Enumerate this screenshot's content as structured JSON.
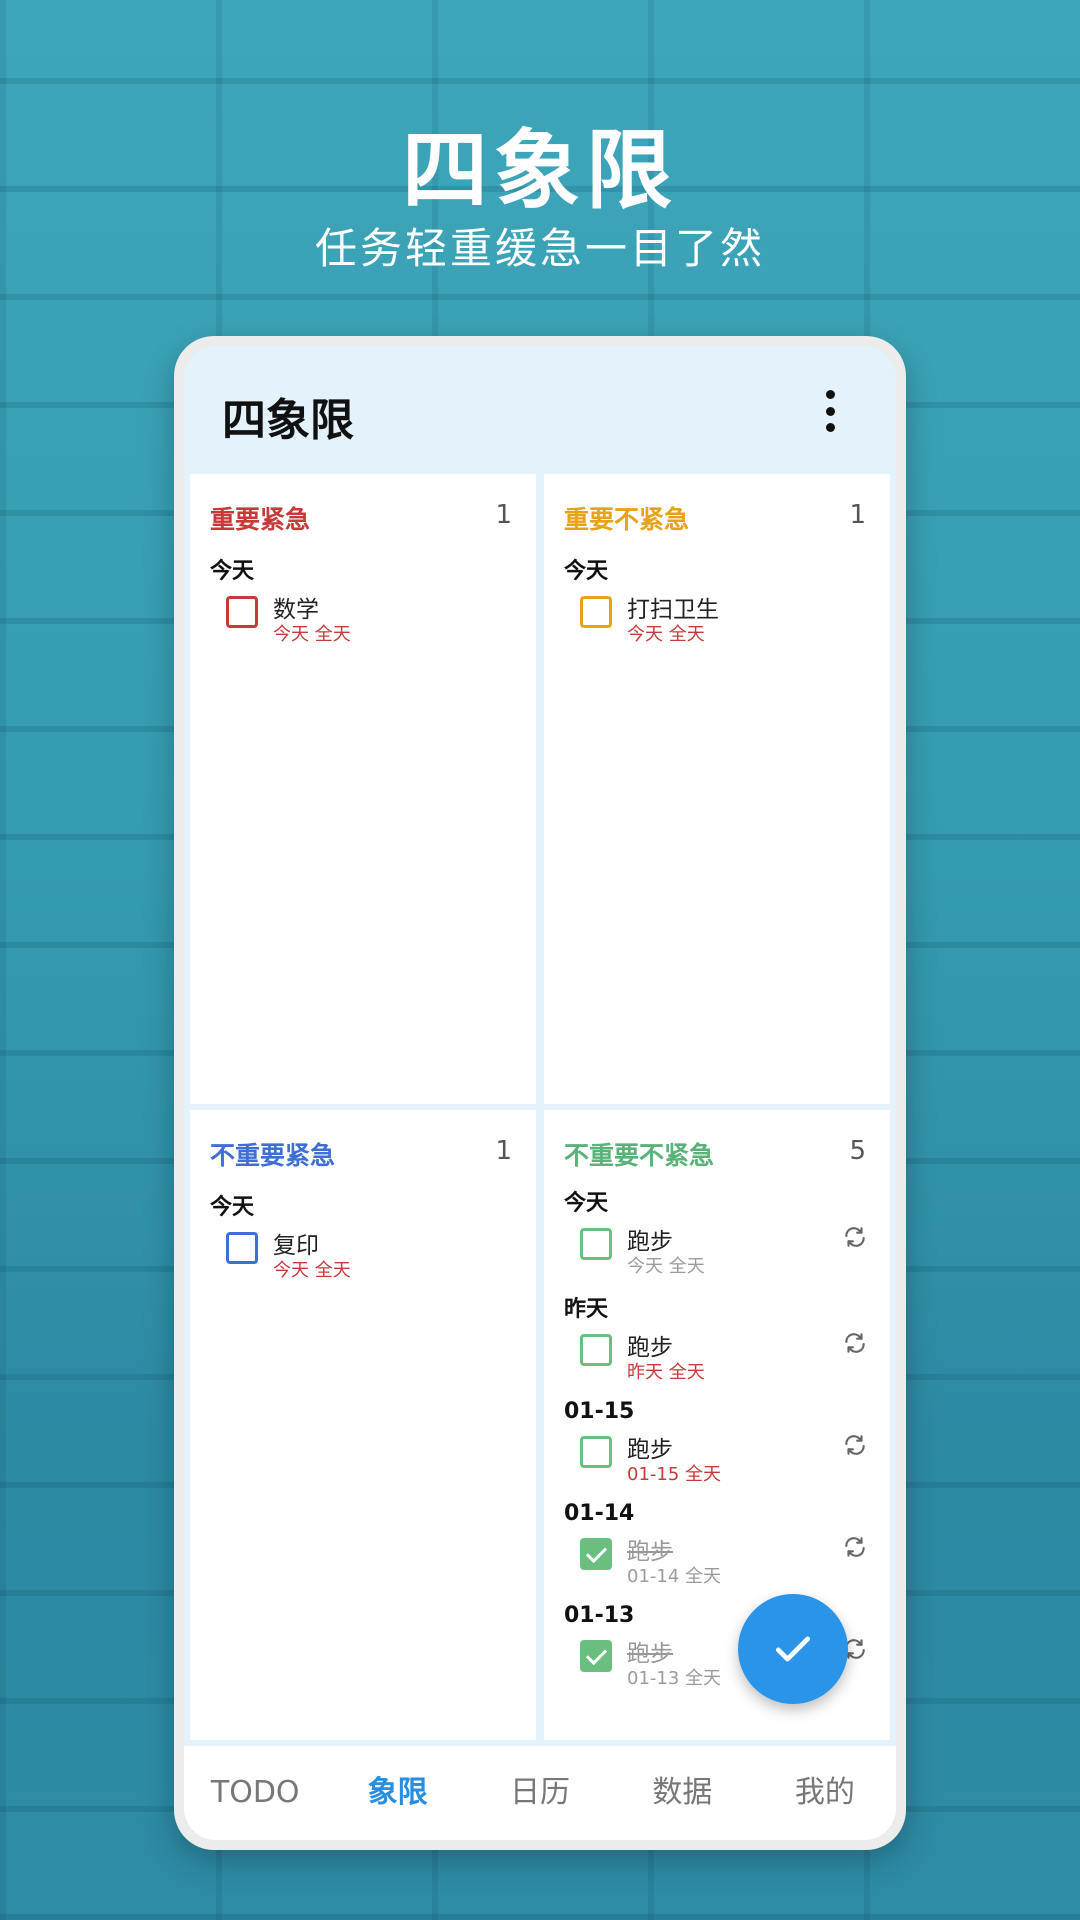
{
  "promo": {
    "title": "四象限",
    "subtitle": "任务轻重缓急一目了然"
  },
  "app": {
    "title": "四象限",
    "menu_icon": "more-vert-icon"
  },
  "colors": {
    "q1": "#c83a3a",
    "q2": "#e8a21a",
    "q3": "#3d6fd6",
    "q4": "#5ab27a",
    "accent": "#2a94e8"
  },
  "quadrants": [
    {
      "title": "重要紧急",
      "count": "1",
      "groups": [
        {
          "label": "今天",
          "tasks": [
            {
              "name": "数学",
              "meta": "今天 全天"
            }
          ]
        }
      ]
    },
    {
      "title": "重要不紧急",
      "count": "1",
      "groups": [
        {
          "label": "今天",
          "tasks": [
            {
              "name": "打扫卫生",
              "meta": "今天 全天"
            }
          ]
        }
      ]
    },
    {
      "title": "不重要紧急",
      "count": "1",
      "groups": [
        {
          "label": "今天",
          "tasks": [
            {
              "name": "复印",
              "meta": "今天 全天"
            }
          ]
        }
      ]
    },
    {
      "title": "不重要不紧急",
      "count": "5",
      "groups": [
        {
          "label": "今天",
          "tasks": [
            {
              "name": "跑步",
              "meta": "今天 全天",
              "repeat": true
            }
          ]
        },
        {
          "label": "昨天",
          "tasks": [
            {
              "name": "跑步",
              "meta": "昨天 全天",
              "repeat": true
            }
          ]
        },
        {
          "label": "01-15",
          "tasks": [
            {
              "name": "跑步",
              "meta": "01-15 全天",
              "repeat": true
            }
          ]
        },
        {
          "label": "01-14",
          "tasks": [
            {
              "name": "跑步",
              "meta": "01-14 全天",
              "repeat": true,
              "done": true
            }
          ]
        },
        {
          "label": "01-13",
          "tasks": [
            {
              "name": "跑步",
              "meta": "01-13 全天",
              "repeat": true,
              "done": true
            }
          ]
        }
      ]
    }
  ],
  "fab_icon": "check-icon",
  "nav": {
    "items": [
      "TODO",
      "象限",
      "日历",
      "数据",
      "我的"
    ],
    "active": "象限"
  }
}
